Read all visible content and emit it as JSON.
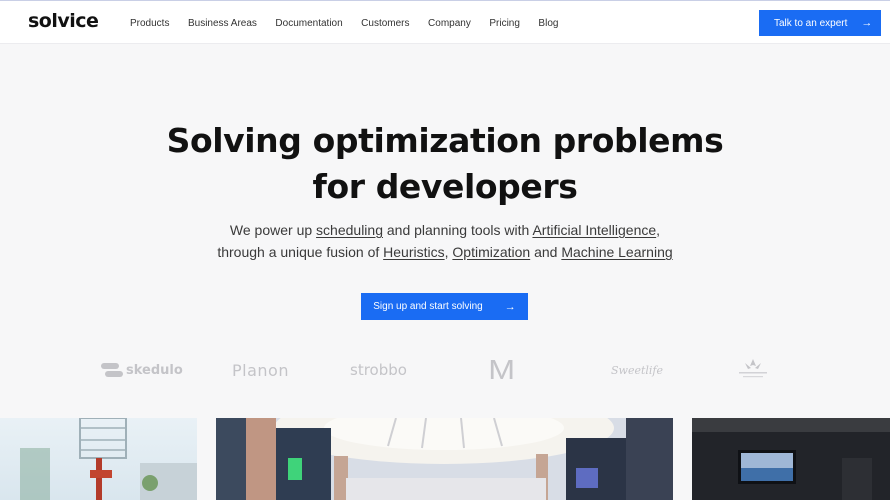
{
  "header": {
    "logo": "solvice",
    "nav": [
      "Products",
      "Business Areas",
      "Documentation",
      "Customers",
      "Company",
      "Pricing",
      "Blog"
    ],
    "cta_label": "Talk to an expert"
  },
  "hero": {
    "title_line1": "Solving optimization problems",
    "title_line2": "for developers",
    "sub_line1_a": "We power up ",
    "sub_link_scheduling": "scheduling",
    "sub_line1_b": " and planning tools with ",
    "sub_link_ai": "Artificial Intelligence",
    "sub_line1_c": ",",
    "sub_line2_a": "through a unique fusion of ",
    "sub_link_heuristics": "Heuristics",
    "sub_comma": ", ",
    "sub_link_optimization": "Optimization",
    "sub_and": " and ",
    "sub_link_ml": "Machine Learning",
    "cta_label": "Sign up and start solving"
  },
  "customer_logos": {
    "skedulo": "skedulo",
    "planon": "Planon",
    "strobbo": "strobbo",
    "mcdonalds": "M",
    "script": "Sweetlife"
  },
  "colors": {
    "accent": "#1a6cf3",
    "logo_grey": "#c4c4c8"
  },
  "icons": {
    "arrow": "arrow-right-icon"
  }
}
